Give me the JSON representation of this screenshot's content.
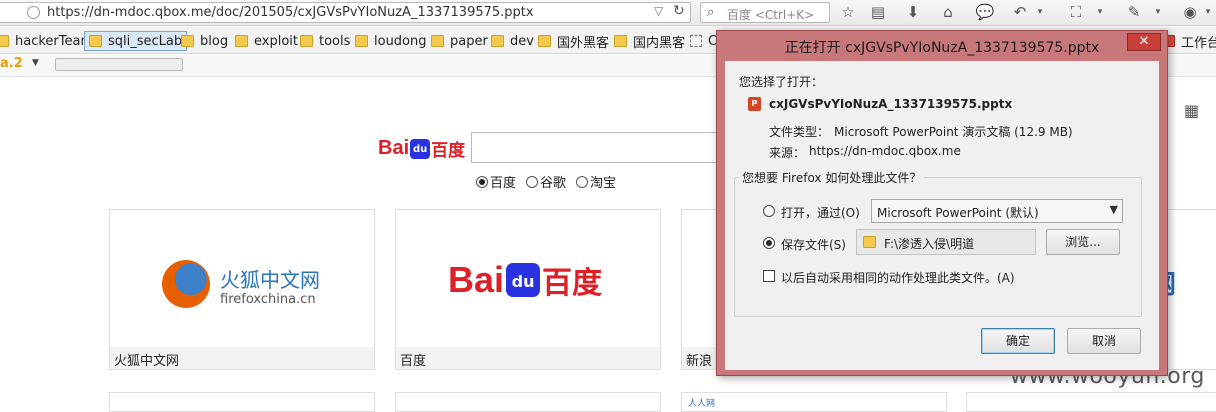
{
  "browser": {
    "url": "https://dn-mdoc.qbox.me/doc/201505/cxJGVsPvYIoNuzA_1337139575.pptx",
    "search_placeholder": "百度 <Ctrl+K>",
    "toolbar_icons": [
      "bookmark-star-icon",
      "reading-list-icon",
      "download-icon",
      "home-icon",
      "chat-icon",
      "undo-icon",
      "crop-icon",
      "extension-icon",
      "menu-icon"
    ]
  },
  "bookmarks": [
    {
      "label": "hackerTeam",
      "icon": "folder-icon"
    },
    {
      "label": "sqli_secLab",
      "icon": "folder-icon",
      "active": true
    },
    {
      "label": "blog",
      "icon": "folder-icon"
    },
    {
      "label": "exploit",
      "icon": "folder-icon"
    },
    {
      "label": "tools",
      "icon": "folder-icon"
    },
    {
      "label": "loudong",
      "icon": "folder-icon"
    },
    {
      "label": "paper",
      "icon": "folder-icon"
    },
    {
      "label": "dev",
      "icon": "folder-icon"
    },
    {
      "label": "国外黑客",
      "icon": "folder-icon"
    },
    {
      "label": "国内黑客",
      "icon": "folder-icon"
    },
    {
      "label": "C",
      "icon": "page-icon"
    },
    {
      "label": "工作台",
      "icon": "app-icon"
    }
  ],
  "addon_bar": {
    "version": "a.2"
  },
  "page": {
    "baidu_logo": {
      "bai": "Bai",
      "du": "du",
      "cn": "百度"
    },
    "engines": [
      {
        "label": "百度",
        "selected": true
      },
      {
        "label": "谷歌",
        "selected": false
      },
      {
        "label": "淘宝",
        "selected": false
      }
    ],
    "cards": [
      {
        "label": "火狐中文网",
        "title": "火狐中文网",
        "subtitle": "firefoxchina.cn"
      },
      {
        "label": "百度"
      },
      {
        "label": "新浪"
      }
    ],
    "right_logo": "网",
    "second_row_text": "人人网"
  },
  "dialog": {
    "title": "正在打开 cxJGVsPvYIoNuzA_1337139575.pptx",
    "close_label": "✕",
    "chosen_label": "您选择了打开：",
    "file_name": "cxJGVsPvYIoNuzA_1337139575.pptx",
    "file_type_label": "文件类型：",
    "file_type_value": "Microsoft PowerPoint 演示文稿 (12.9 MB)",
    "source_label": "来源：",
    "source_value": "https://dn-mdoc.qbox.me",
    "question": "您想要 Firefox 如何处理此文件？",
    "open_with_label": "打开，通过(O)",
    "open_with_app": "Microsoft PowerPoint (默认)",
    "save_label": "保存文件(S)",
    "save_path": "F:\\渗透入侵\\明道",
    "browse_label": "浏览...",
    "auto_label": "以后自动采用相同的动作处理此类文件。(A)",
    "ok_label": "确定",
    "cancel_label": "取消",
    "selected_option": "save"
  },
  "watermark": "www.wooyun.org"
}
